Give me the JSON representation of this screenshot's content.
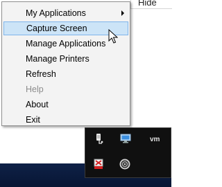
{
  "background_window": {
    "hide_label": "Hide"
  },
  "menu": {
    "items": [
      {
        "label": "My Applications",
        "submenu": true,
        "state": "normal"
      },
      {
        "label": "Capture Screen",
        "submenu": false,
        "state": "highlighted"
      },
      {
        "label": "Manage Applications",
        "submenu": false,
        "state": "normal"
      },
      {
        "label": "Manage Printers",
        "submenu": false,
        "state": "normal"
      },
      {
        "label": "Refresh",
        "submenu": false,
        "state": "normal"
      },
      {
        "label": "Help",
        "submenu": false,
        "state": "disabled"
      },
      {
        "label": "About",
        "submenu": false,
        "state": "normal"
      },
      {
        "label": "Exit",
        "submenu": false,
        "state": "normal"
      }
    ]
  },
  "tray": {
    "icons": [
      "usb-device-icon",
      "monitor-icon",
      "vmware-icon",
      "red-flag-icon",
      "swirl-icon"
    ],
    "vm_text": "vm"
  },
  "colors": {
    "menu_bg": "#f3f3f3",
    "highlight_bg": "#cce4f7",
    "highlight_border": "#7eb4ea",
    "taskbar_bg": "#0b1b3a",
    "tray_bg": "#101010"
  }
}
